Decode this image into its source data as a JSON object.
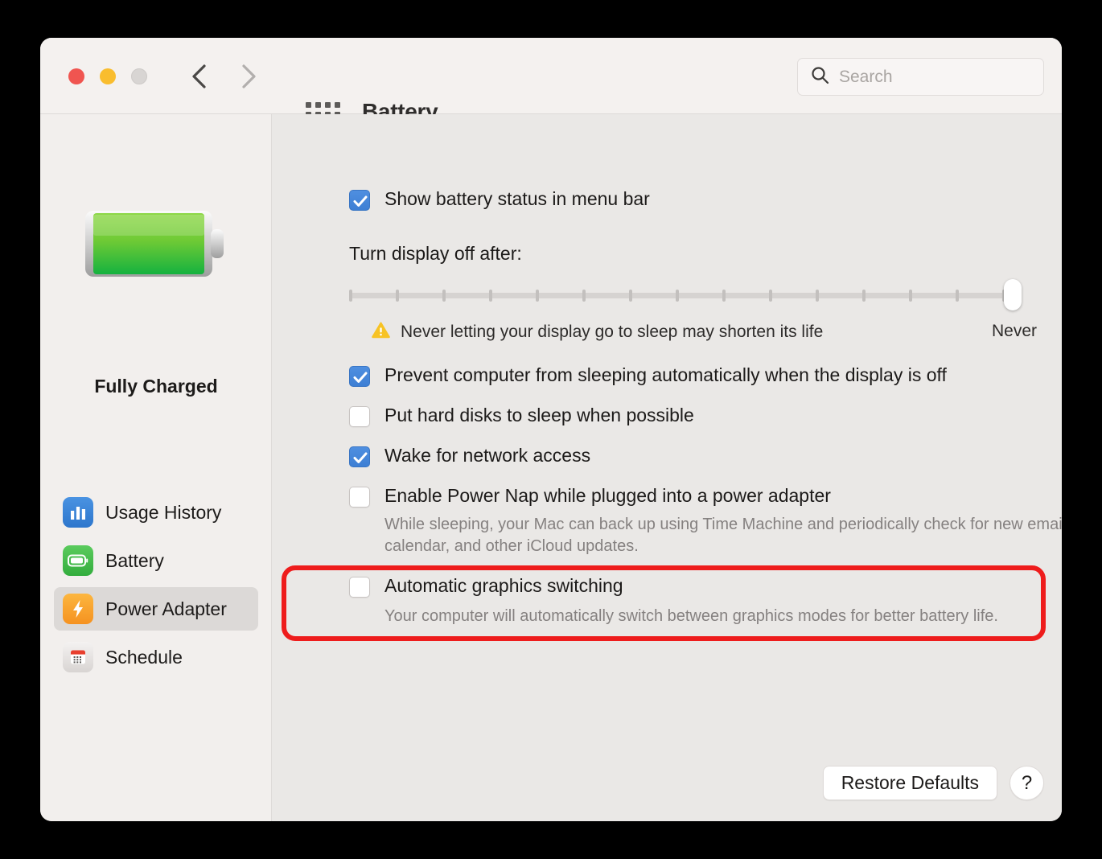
{
  "window": {
    "title": "Battery",
    "traffic_lights": [
      "close-red",
      "minimize-yellow",
      "zoom-gray"
    ],
    "back_label": "Back",
    "forward_label": "Forward",
    "grid_label": "Show All",
    "accent_blue": "#3d7fd4",
    "annotation_color": "#ee1c1c"
  },
  "search": {
    "placeholder": "Search",
    "value": "",
    "icon": "search-icon"
  },
  "sidebar": {
    "battery_icon": "battery-full-icon",
    "status": "Fully Charged",
    "items": [
      {
        "label": "Usage History",
        "icon": "bar-chart-icon",
        "selected": false
      },
      {
        "label": "Battery",
        "icon": "battery-icon",
        "selected": false
      },
      {
        "label": "Power Adapter",
        "icon": "lightning-bolt-icon",
        "selected": true
      },
      {
        "label": "Schedule",
        "icon": "calendar-icon",
        "selected": false
      }
    ]
  },
  "main": {
    "show_status": {
      "label": "Show battery status in menu bar",
      "checked": true
    },
    "display_off": {
      "label": "Turn display off after:",
      "tick_count": 15,
      "thumb_position": "Never",
      "right_label": "Never",
      "warning_icon": "warning-triangle-icon",
      "warning_text": "Never letting your display go to sleep may shorten its life"
    },
    "options": [
      {
        "label": "Prevent computer from sleeping automatically when the display is off",
        "checked": true
      },
      {
        "label": "Put hard disks to sleep when possible",
        "checked": false
      },
      {
        "label": "Wake for network access",
        "checked": true
      },
      {
        "label": "Enable Power Nap while plugged into a power adapter",
        "checked": false
      }
    ],
    "power_nap_desc_line1": "While sleeping, your Mac can back up using Time Machine and periodically check for",
    "power_nap_desc_line2": "new email, calendar, and other iCloud updates.",
    "graphics": {
      "label": "Automatic graphics switching",
      "checked": false,
      "desc": "Your computer will automatically switch between graphics modes for better battery life.",
      "highlighted": true
    },
    "restore_label": "Restore Defaults",
    "help_label": "?"
  }
}
